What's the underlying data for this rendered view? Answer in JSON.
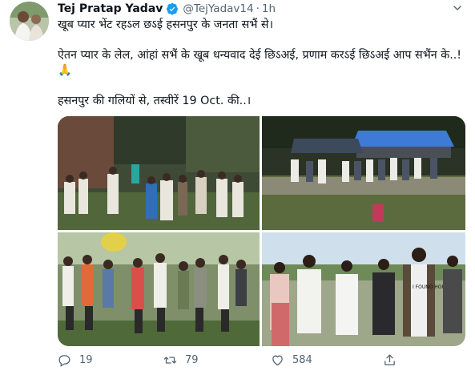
{
  "tweet": {
    "author_name": "Tej Pratap Yadav",
    "handle": "@TejYadav14",
    "separator": "·",
    "time": "1h",
    "lines": [
      "खूब प्यार भेंट रहऽल छऽई हसनपुर के जनता सभैं से।",
      "ऐतन प्यार के लेल, आंहां सभैं के खूब धन्यवाद देई छिऽअई, प्रणाम करऽई छिऽअई आप सभैंन के..!🙏",
      "हसनपुर की गलियों से, तस्वीरें 19 Oct. की..।"
    ]
  },
  "photos": [
    {
      "name": "photo-1",
      "sign_text": "",
      "banner": ""
    },
    {
      "name": "photo-2",
      "sign_text": "",
      "banner": ""
    },
    {
      "name": "photo-3",
      "sign_text": "",
      "banner": ""
    },
    {
      "name": "photo-4",
      "shirt_text": "I FOUND HOPE"
    }
  ],
  "actions": {
    "reply_count": "19",
    "retweet_count": "79",
    "like_count": "584"
  },
  "colors": {
    "text": "#0f1419",
    "secondary": "#536471",
    "verified": "#1d9bf0"
  }
}
